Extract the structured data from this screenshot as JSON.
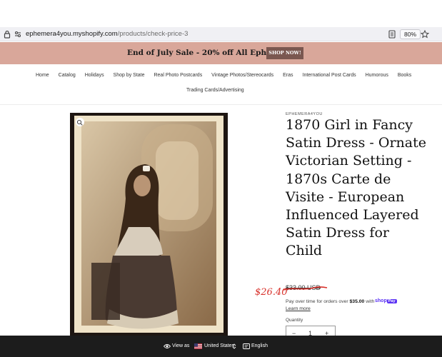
{
  "browser": {
    "url_host": "ephemera4you.myshopify.com",
    "url_path": "/products/check-price-3",
    "zoom": "80%",
    "icons": [
      "lock-icon",
      "tune-icon",
      "reader-view-icon",
      "bookmark-star-icon"
    ]
  },
  "banner": {
    "message": "End of July Sale - 20% off All Ephemera!",
    "button": "SHOP NOW!",
    "color": "#d9a79a"
  },
  "nav": {
    "items": [
      "Home",
      "Catalog",
      "Holidays",
      "Shop by State",
      "Real Photo Postcards",
      "Vintage Photos/Stereocards",
      "Eras",
      "International Post Cards",
      "Humorous",
      "Books"
    ],
    "second_row": "Trading Cards/Advertising"
  },
  "product": {
    "vendor": "EPHEMERA4YOU",
    "title": "1870 Girl in Fancy Satin Dress - Ornate Victorian Setting - 1870s Carte de Visite - European Influenced Layered Satin Dress for Child",
    "price_original": "$33.00 USD",
    "handwritten_price": "$26.40",
    "installments_prefix": "Pay over time for orders over ",
    "installments_amount": "$35.00",
    "installments_suffix": " with ",
    "shoppay_brand": "shop",
    "shoppay_pay": "Pay",
    "learn_more": "Learn more",
    "quantity_label": "Quantity",
    "quantity": "1",
    "minus": "−",
    "plus": "+"
  },
  "footer": {
    "view_as": "View as",
    "country": "United States",
    "language": "English"
  }
}
